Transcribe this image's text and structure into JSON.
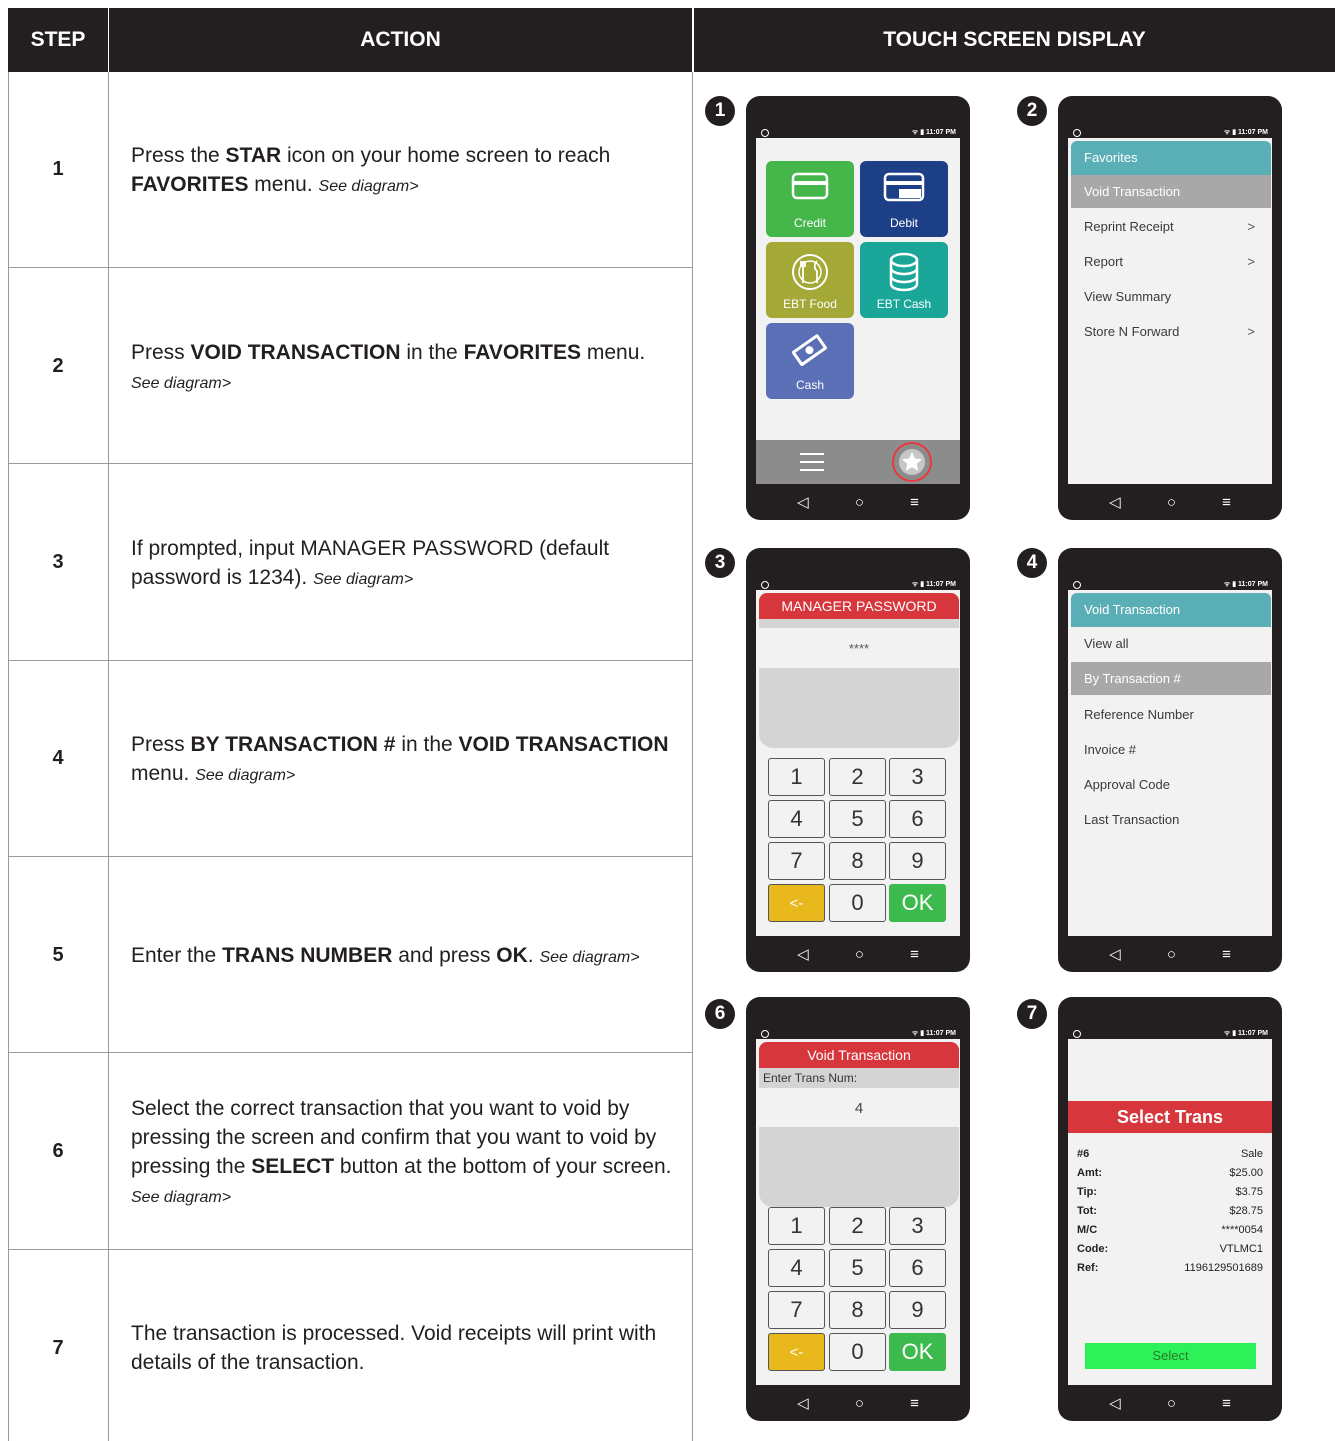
{
  "table": {
    "headers": {
      "step": "STEP",
      "action": "ACTION",
      "display": "TOUCH SCREEN DISPLAY"
    },
    "steps": [
      {
        "num": "1",
        "t1": "Press the ",
        "b1": "STAR",
        "t2": " icon on your home screen to reach ",
        "b2": "FAVORITES",
        "t3": " menu. ",
        "see": "See diagram>"
      },
      {
        "num": "2",
        "t1": "Press ",
        "b1": "VOID TRANSACTION",
        "t2": " in the ",
        "b2": "FAVORITES",
        "t3": " menu. ",
        "see": "See diagram>"
      },
      {
        "num": "3",
        "t1": "If prompted, input MANAGER PASSWORD (default password is 1234). ",
        "see": "See diagram>"
      },
      {
        "num": "4",
        "t1": "Press ",
        "b1": "BY TRANSACTION #",
        "t2": " in the ",
        "b2": "VOID TRANSACTION",
        "t3": " menu. ",
        "see": "See diagram>"
      },
      {
        "num": "5",
        "t1": "Enter the ",
        "b1": "TRANS NUMBER",
        "t2": " and press ",
        "b2": "OK",
        "t3": ". ",
        "see": "See diagram>"
      },
      {
        "num": "6",
        "t1": "Select the correct transaction that you want to void by pressing the screen and confirm that you want to void by pressing the ",
        "b1": "SELECT",
        "t2": " button at the bottom of your screen. ",
        "see": "See diagram>"
      },
      {
        "num": "7",
        "t1": "The transaction is processed. Void receipts will print with details of the transaction."
      }
    ]
  },
  "phones": {
    "status_time": "11:07 PM",
    "nav": {
      "back": "◁",
      "home": "○",
      "menu": "≡"
    },
    "badges": [
      "1",
      "2",
      "3",
      "4",
      "6",
      "7"
    ],
    "home": {
      "tiles": [
        {
          "label": "Credit",
          "color": "#45b649",
          "icon": "credit-card-icon"
        },
        {
          "label": "Debit",
          "color": "#1d3f88",
          "icon": "debit-card-icon",
          "card_text": "DEBIT"
        },
        {
          "label": "EBT Food",
          "color": "#a3a836",
          "icon": "food-icon"
        },
        {
          "label": "EBT Cash",
          "color": "#1aa79a",
          "icon": "coins-icon"
        },
        {
          "label": "Cash",
          "color": "#5a6fb5",
          "icon": "cash-icon"
        }
      ]
    },
    "favorites": {
      "title": "Favorites",
      "items": [
        {
          "label": "Void Transaction",
          "chev": ""
        },
        {
          "label": "Reprint Receipt",
          "chev": ">"
        },
        {
          "label": "Report",
          "chev": ">"
        },
        {
          "label": "View Summary",
          "chev": ""
        },
        {
          "label": "Store N Forward",
          "chev": ">"
        }
      ]
    },
    "manager": {
      "title": "MANAGER PASSWORD",
      "value": "****"
    },
    "void_menu": {
      "title": "Void Transaction",
      "items": [
        {
          "label": "View all"
        },
        {
          "label": "By Transaction #"
        },
        {
          "label": "Reference Number"
        },
        {
          "label": "Invoice #"
        },
        {
          "label": "Approval Code"
        },
        {
          "label": "Last Transaction"
        }
      ]
    },
    "trans_entry": {
      "title": "Void Transaction",
      "prompt": "Enter Trans Num:",
      "value": "4"
    },
    "keypad": [
      "1",
      "2",
      "3",
      "4",
      "5",
      "6",
      "7",
      "8",
      "9",
      "<-",
      "0",
      "OK"
    ],
    "select_trans": {
      "title": "Select Trans",
      "rows": [
        {
          "k": "#6",
          "v": "Sale"
        },
        {
          "k": "Amt:",
          "v": "$25.00"
        },
        {
          "k": "Tip:",
          "v": "$3.75"
        },
        {
          "k": "Tot:",
          "v": "$28.75"
        },
        {
          "k": "M/C",
          "v": "****0054"
        },
        {
          "k": "Code:",
          "v": "VTLMC1"
        },
        {
          "k": "Ref:",
          "v": "1196129501689"
        }
      ],
      "button": "Select"
    }
  }
}
